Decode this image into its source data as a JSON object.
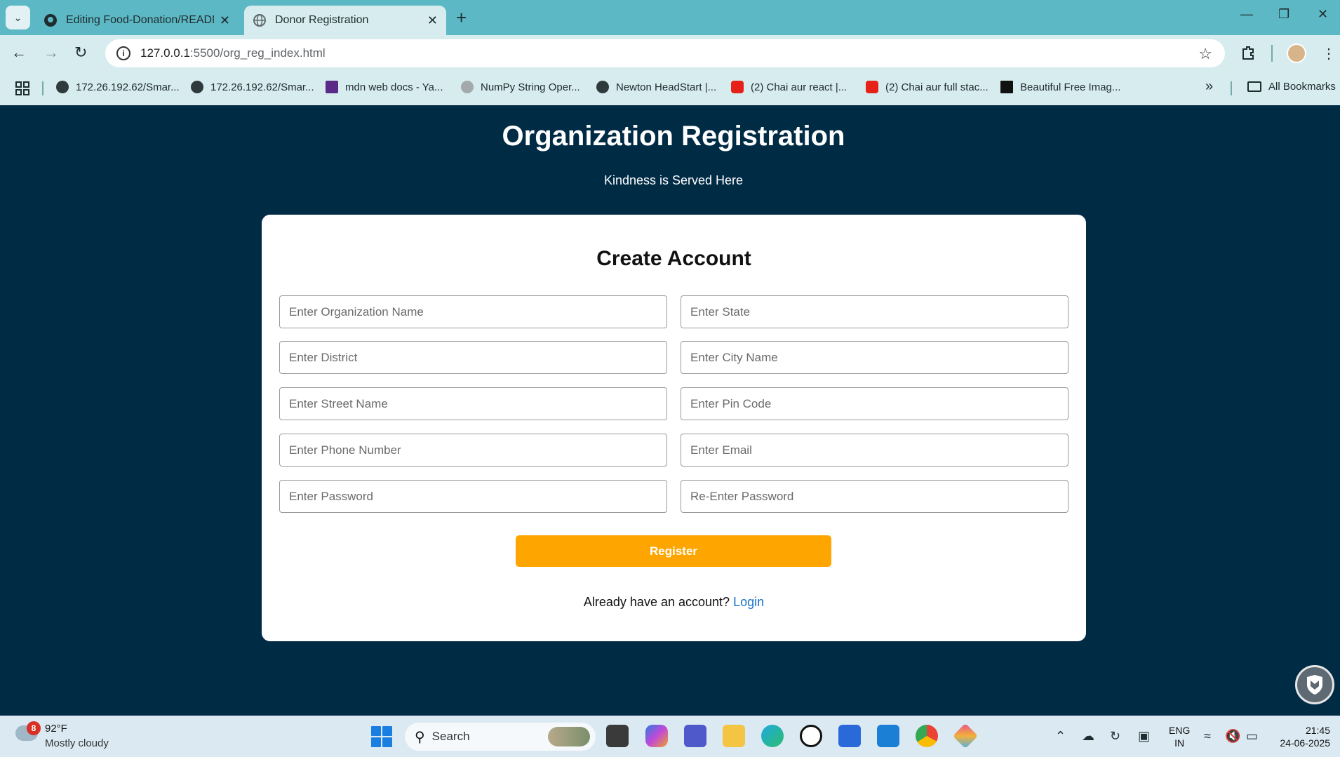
{
  "browser": {
    "tabs": [
      {
        "title": "Editing Food-Donation/READM",
        "active": false,
        "favicon": "github-icon"
      },
      {
        "title": "Donor Registration",
        "active": true,
        "favicon": "globe-icon"
      }
    ],
    "address_host": "127.0.0.1",
    "address_path": ":5500/org_reg_index.html",
    "bookmarks": [
      {
        "label": "172.26.192.62/Smar...",
        "icon": "globe-icon"
      },
      {
        "label": "172.26.192.62/Smar...",
        "icon": "globe-icon"
      },
      {
        "label": "mdn web docs - Ya...",
        "icon": "yahoo-icon"
      },
      {
        "label": "NumPy String Oper...",
        "icon": "numpy-icon"
      },
      {
        "label": "Newton HeadStart |...",
        "icon": "globe-icon"
      },
      {
        "label": "(2) Chai aur react |...",
        "icon": "youtube-icon"
      },
      {
        "label": "(2) Chai aur full stac...",
        "icon": "youtube-icon"
      },
      {
        "label": "Beautiful Free Imag...",
        "icon": "unsplash-icon"
      }
    ],
    "all_bookmarks_label": "All Bookmarks"
  },
  "page": {
    "title": "Organization Registration",
    "subtitle": "Kindness is Served Here",
    "card_title": "Create Account",
    "fields": {
      "org_name": "Enter Organization Name",
      "state": "Enter State",
      "district": "Enter District",
      "city": "Enter City Name",
      "street": "Enter Street Name",
      "pin": "Enter Pin Code",
      "phone": "Enter Phone Number",
      "email": "Enter Email",
      "password": "Enter Password",
      "password_confirm": "Re-Enter Password"
    },
    "register_label": "Register",
    "login_prompt": "Already have an account?",
    "login_link": "Login"
  },
  "taskbar": {
    "weather_temp": "92°F",
    "weather_desc": "Mostly cloudy",
    "weather_badge": "8",
    "search_label": "Search",
    "lang_line1": "ENG",
    "lang_line2": "IN",
    "time": "21:45",
    "date": "24-06-2025"
  },
  "colors": {
    "page_bg": "#002b45",
    "button": "#ffa500",
    "link": "#1a73c8",
    "tabbar": "#5cb8c4"
  }
}
